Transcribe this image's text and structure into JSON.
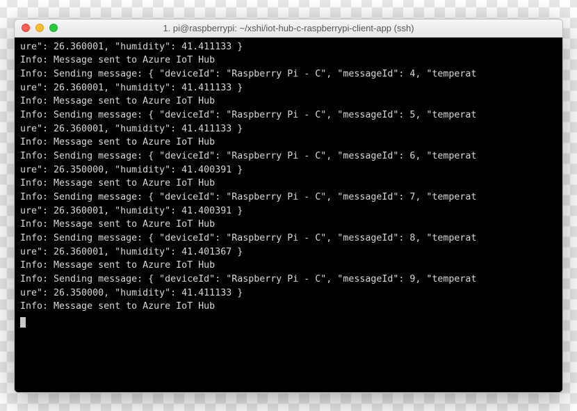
{
  "window": {
    "title": "1. pi@raspberrypi: ~/xshi/iot-hub-c-raspberrypi-client-app (ssh)"
  },
  "terminal": {
    "lines": [
      "ure\": 26.360001, \"humidity\": 41.411133 }",
      "Info: Message sent to Azure IoT Hub",
      "Info: Sending message: { \"deviceId\": \"Raspberry Pi - C\", \"messageId\": 4, \"temperat",
      "ure\": 26.360001, \"humidity\": 41.411133 }",
      "Info: Message sent to Azure IoT Hub",
      "Info: Sending message: { \"deviceId\": \"Raspberry Pi - C\", \"messageId\": 5, \"temperat",
      "ure\": 26.360001, \"humidity\": 41.411133 }",
      "Info: Message sent to Azure IoT Hub",
      "Info: Sending message: { \"deviceId\": \"Raspberry Pi - C\", \"messageId\": 6, \"temperat",
      "ure\": 26.350000, \"humidity\": 41.400391 }",
      "Info: Message sent to Azure IoT Hub",
      "Info: Sending message: { \"deviceId\": \"Raspberry Pi - C\", \"messageId\": 7, \"temperat",
      "ure\": 26.360001, \"humidity\": 41.400391 }",
      "Info: Message sent to Azure IoT Hub",
      "Info: Sending message: { \"deviceId\": \"Raspberry Pi - C\", \"messageId\": 8, \"temperat",
      "ure\": 26.360001, \"humidity\": 41.401367 }",
      "Info: Message sent to Azure IoT Hub",
      "Info: Sending message: { \"deviceId\": \"Raspberry Pi - C\", \"messageId\": 9, \"temperat",
      "ure\": 26.350000, \"humidity\": 41.411133 }",
      "Info: Message sent to Azure IoT Hub"
    ]
  }
}
